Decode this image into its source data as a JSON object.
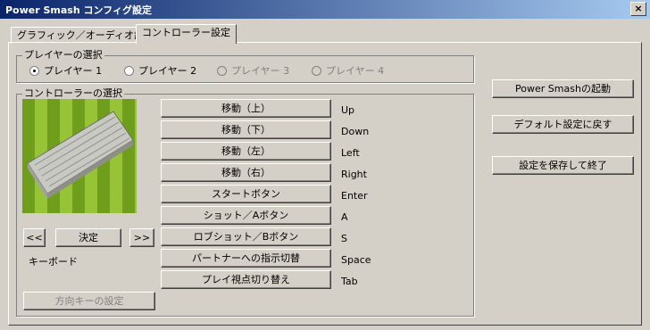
{
  "window": {
    "title": "Power Smash コンフィグ設定",
    "close_label": "×"
  },
  "tabs": [
    {
      "label": "グラフィック／オーディオ設定"
    },
    {
      "label": "コントローラー設定"
    }
  ],
  "player_group": {
    "label": "プレイヤーの選択",
    "options": [
      {
        "label": "プレイヤー 1",
        "selected": true,
        "enabled": true
      },
      {
        "label": "プレイヤー 2",
        "selected": false,
        "enabled": true
      },
      {
        "label": "プレイヤー 3",
        "selected": false,
        "enabled": false
      },
      {
        "label": "プレイヤー 4",
        "selected": false,
        "enabled": false
      }
    ]
  },
  "controller_group": {
    "label": "コントローラーの選択",
    "device_name": "キーボード",
    "prev_label": "<<",
    "next_label": ">>",
    "confirm_label": "決定",
    "direction_keys_label": "方向キーの設定"
  },
  "bindings": [
    {
      "action": "移動（上）",
      "key": "Up"
    },
    {
      "action": "移動（下）",
      "key": "Down"
    },
    {
      "action": "移動（左）",
      "key": "Left"
    },
    {
      "action": "移動（右）",
      "key": "Right"
    },
    {
      "action": "スタートボタン",
      "key": "Enter"
    },
    {
      "action": "ショット／Aボタン",
      "key": "A"
    },
    {
      "action": "ロブショット／Bボタン",
      "key": "S"
    },
    {
      "action": "パートナーへの指示切替",
      "key": "Space"
    },
    {
      "action": "プレイ視点切り替え",
      "key": "Tab"
    }
  ],
  "side_buttons": {
    "launch": "Power Smashの起動",
    "restore_defaults": "デフォルト設定に戻す",
    "save_exit": "設定を保存して終了"
  },
  "colors": {
    "titlebar_start": "#0a246a",
    "titlebar_end": "#a6caf0",
    "face": "#d4d0c8"
  }
}
